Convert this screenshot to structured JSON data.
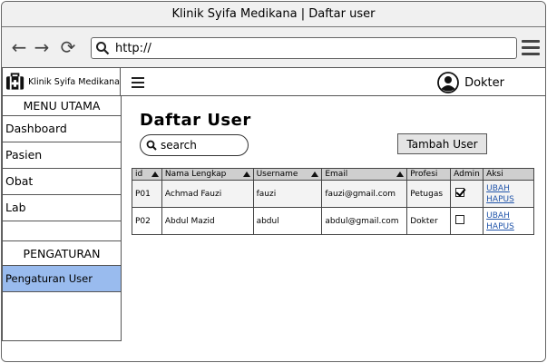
{
  "window": {
    "title": "Klinik Syifa Medikana | Daftar user"
  },
  "browser": {
    "url": "http://"
  },
  "brand": {
    "name": "Klinik Syifa Medikana"
  },
  "topbar": {
    "user_name": "Dokter"
  },
  "sidebar": {
    "heading_main": "MENU UTAMA",
    "items": [
      {
        "label": "Dashboard"
      },
      {
        "label": "Pasien"
      },
      {
        "label": "Obat"
      },
      {
        "label": "Lab"
      }
    ],
    "heading_settings": "PENGATURAN",
    "settings_items": [
      {
        "label": "Pengaturan User",
        "active": true
      }
    ]
  },
  "main": {
    "title": "Daftar User",
    "search_placeholder": "search",
    "add_button": "Tambah User"
  },
  "table": {
    "headers": [
      "id",
      "Nama Lengkap",
      "Username",
      "Email",
      "Profesi",
      "Admin",
      "Aksi"
    ],
    "rows": [
      {
        "id": "P01",
        "name": "Achmad Fauzi",
        "username": "fauzi",
        "email": "fauzi@gmail.com",
        "profesi": "Petugas",
        "admin": true,
        "edit": "UBAH",
        "delete": "HAPUS"
      },
      {
        "id": "P02",
        "name": "Abdul Mazid",
        "username": "abdul",
        "email": "abdul@gmail.com",
        "profesi": "Dokter",
        "admin": false,
        "edit": "UBAH",
        "delete": "HAPUS"
      }
    ]
  }
}
